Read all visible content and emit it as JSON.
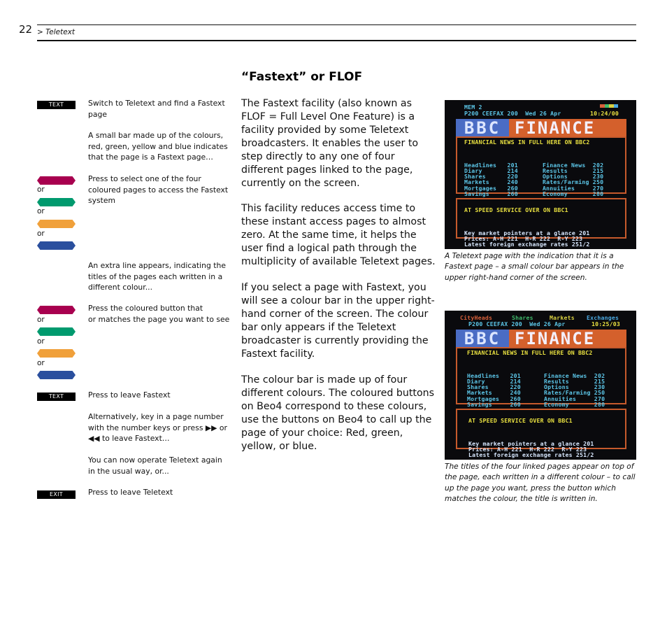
{
  "header": {
    "page_number": "22",
    "section": "> Teletext"
  },
  "title": "“Fastext” or FLOF",
  "colors": {
    "red": "#a8004f",
    "green": "#009a6e",
    "yellow": "#f0a03a",
    "blue": "#2a4f9e",
    "key_bg": "#000000"
  },
  "steps": {
    "key_text_1": "TEXT",
    "step1": "Switch to Teletext and find a Fastext page",
    "step1b": "A small bar made up of the colours, red, green, yellow and blue indicates that the page is a Fastext page…",
    "or": "or",
    "step2": "Press to select one of the four coloured pages to access the Fastext system",
    "step3": "An extra line appears, indicating the titles of the pages each written in a different colour...",
    "step4": "Press the coloured button that",
    "step4b": "or matches the page you want to see",
    "key_text_2": "TEXT",
    "step5": "Press to leave Fastext",
    "step5b": "Alternatively, key in a page number with the number keys or press ▶▶ or ◀◀ to leave Fastext…",
    "step6": "You can now operate Teletext again in the usual way, or...",
    "key_exit": "EXIT",
    "step7": "Press to leave Teletext"
  },
  "body": {
    "p1": "The Fastext facility (also known as FLOF = Full Level One Feature) is a facility provided by some Teletext broadcasters. It enables the user to step directly to any one of four different pages linked to the page, currently on the screen.",
    "p2": "This facility reduces access time to these instant access pages to almost zero. At the same time, it helps the user find a logical path through the multiplicity of available Teletext pages.",
    "p3": "If you select a page with Fastext, you will see a colour bar in the upper right-hand corner of the screen. The colour bar only appears if the Teletext broadcaster is currently providing the Fastext facility.",
    "p4": "The colour bar is made up of four different colours. The coloured buttons on Beo4 correspond to these colours, use the buttons on Beo4 to call up the page of your choice: Red, green, yellow, or blue."
  },
  "screens": [
    {
      "top_line": "MEM 2",
      "status_line": "P200 CEEFAX 200  Wed 26 Apr",
      "time": "10:24/00",
      "banner_left": "BBC",
      "banner_right": "FINANCE",
      "headline": "FINANCIAL NEWS IN FULL HERE ON BBC2",
      "index_left": [
        "Headlines   201",
        "Diary       214",
        "Shares      220",
        "Markets     240",
        "Mortgages   260",
        "Savings     260"
      ],
      "index_right": [
        "Finance News  202",
        "Results       215",
        "Options       230",
        "Rates/Farming 250",
        "Annuities     270",
        "Economy       280"
      ],
      "promo": "AT SPEED SERVICE OVER ON BBC1",
      "info": [
        "Key market pointers at a glance 201",
        "Prices: A-H 221  H-R 222  R-Y 223",
        "Latest foreign exchange rates 251/2"
      ],
      "caption": "A Teletext page with the indication that it is a Fastext page – a small colour bar appears in the upper right-hand corner of the screen."
    },
    {
      "fastext_links": [
        "CityHeads",
        "Shares",
        "Markets",
        "Exchanges"
      ],
      "status_line": "P200 CEEFAX 200  Wed 26 Apr",
      "time": "10:25/03",
      "banner_left": "BBC",
      "banner_right": "FINANCE",
      "headline": "FINANCIAL NEWS IN FULL HERE ON BBC2",
      "index_left": [
        "Headlines   201",
        "Diary       214",
        "Shares      220",
        "Markets     240",
        "Mortgages   260",
        "Savings     260"
      ],
      "index_right": [
        "Finance News  202",
        "Results       215",
        "Options       230",
        "Rates/Farming 250",
        "Annuities     270",
        "Economy       280"
      ],
      "promo": "AT SPEED SERVICE OVER ON BBC1",
      "info": [
        "Key market pointers at a glance 201",
        "Prices: A-H 221  H-R 222  R-Y 223",
        "Latest foreign exchange rates 251/2"
      ],
      "caption": "The titles of the four linked pages appear on top of the page, each written in a different colour – to call up the page you want, press the button which matches the colour, the title is written in."
    }
  ]
}
